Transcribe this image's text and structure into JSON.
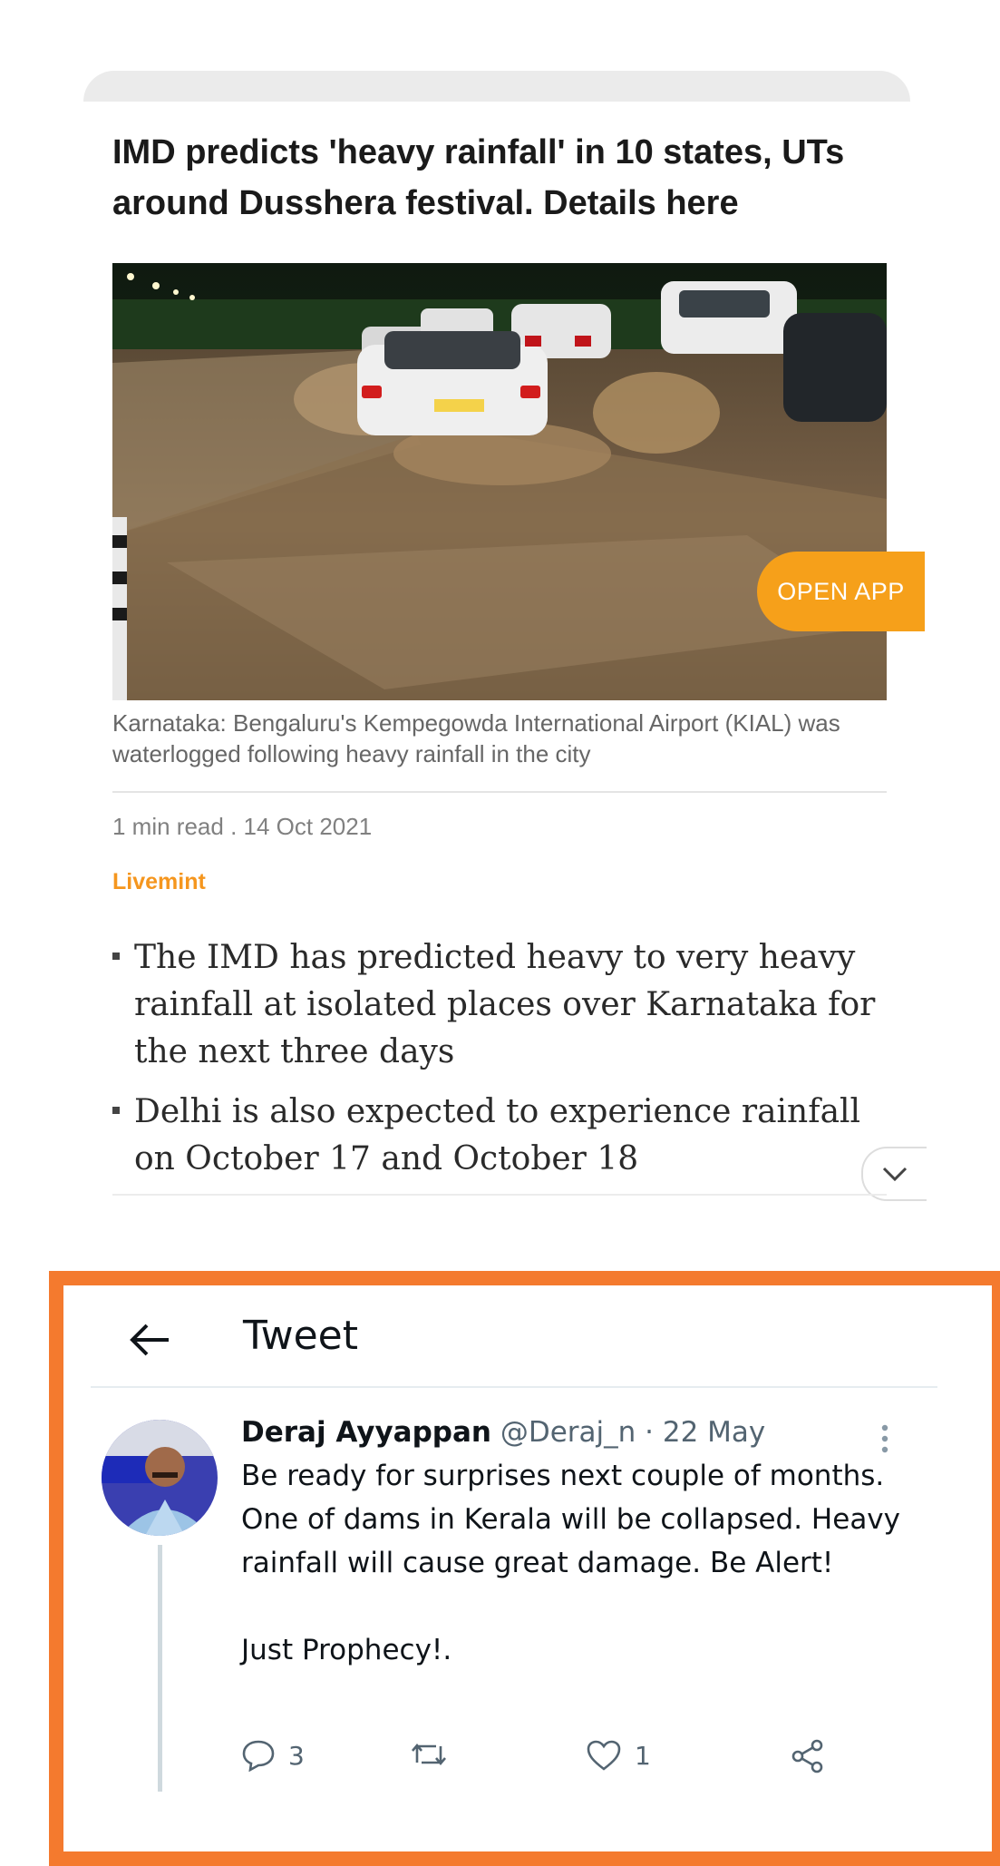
{
  "article": {
    "headline": "IMD predicts 'heavy rainfall' in 10 states, UTs around Dusshera festival. Details here",
    "caption": "Karnataka: Bengaluru's Kempegowda International Airport (KIAL) was waterlogged following heavy rainfall in the city",
    "meta": "1 min read . 14 Oct 2021",
    "source": "Livemint",
    "bullets": [
      "The IMD has predicted heavy to very heavy rainfall at isolated places over Karnataka for the next three days",
      "Delhi is also expected to experience rainfall on October 17 and October 18"
    ],
    "open_app_label": "OPEN APP",
    "accent_color": "#f6a01a"
  },
  "tweet": {
    "header_title": "Tweet",
    "author_name": "Deraj Ayyappan",
    "author_handle": "@Deraj_n",
    "separator": " · ",
    "date": "22 May",
    "text": "Be ready for surprises next couple of months. One of dams in Kerala will be collapsed. Heavy rainfall will cause great damage. Be Alert!\n\nJust Prophecy!.",
    "replies": "3",
    "likes": "1",
    "frame_color": "#f47a2e",
    "icons": [
      "back-arrow-icon",
      "more-vertical-icon",
      "reply-icon",
      "retweet-icon",
      "like-icon",
      "share-icon"
    ]
  }
}
